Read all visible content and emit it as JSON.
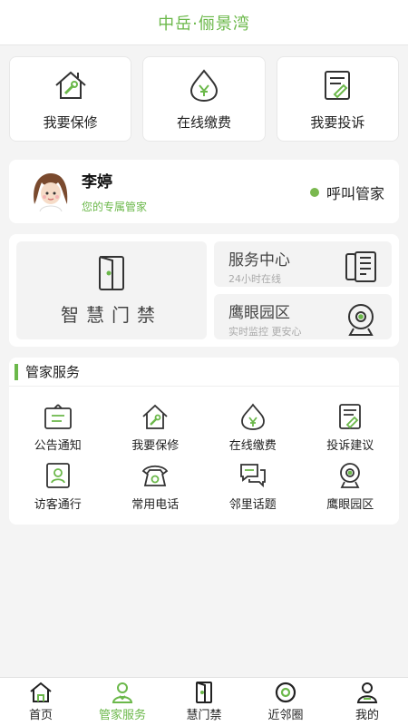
{
  "header": {
    "title": "中岳·俪景湾"
  },
  "quick_actions": [
    {
      "label": "我要保修",
      "icon": "house-wrench-icon"
    },
    {
      "label": "在线缴费",
      "icon": "yuan-drop-icon"
    },
    {
      "label": "我要投诉",
      "icon": "notepad-pen-icon"
    }
  ],
  "butler": {
    "name": "李婷",
    "subtitle": "您的专属管家",
    "call_label": "呼叫管家",
    "status_color": "#7ab84f"
  },
  "access": {
    "smart_door_label": "智慧门禁",
    "service_center": {
      "title": "服务中心",
      "subtitle": "24小时在线"
    },
    "eagle_eye": {
      "title": "鹰眼园区",
      "subtitle": "实时监控 更安心"
    }
  },
  "services": {
    "title": "管家服务",
    "items": [
      {
        "label": "公告通知",
        "icon": "notice-board-icon"
      },
      {
        "label": "我要保修",
        "icon": "house-wrench-icon"
      },
      {
        "label": "在线缴费",
        "icon": "yuan-drop-icon"
      },
      {
        "label": "投诉建议",
        "icon": "notepad-pen-icon"
      },
      {
        "label": "访客通行",
        "icon": "visitor-card-icon"
      },
      {
        "label": "常用电话",
        "icon": "telephone-icon"
      },
      {
        "label": "邻里话题",
        "icon": "chat-bubbles-icon"
      },
      {
        "label": "鹰眼园区",
        "icon": "webcam-icon"
      }
    ]
  },
  "tabbar": [
    {
      "label": "首页",
      "icon": "home-icon"
    },
    {
      "label": "管家服务",
      "icon": "butler-icon",
      "active": true
    },
    {
      "label": "慧门禁",
      "icon": "door-icon"
    },
    {
      "label": "近邻圈",
      "icon": "circle-icon"
    },
    {
      "label": "我的",
      "icon": "user-icon"
    }
  ],
  "colors": {
    "accent": "#6bb84a",
    "background": "#f4f4f4"
  }
}
